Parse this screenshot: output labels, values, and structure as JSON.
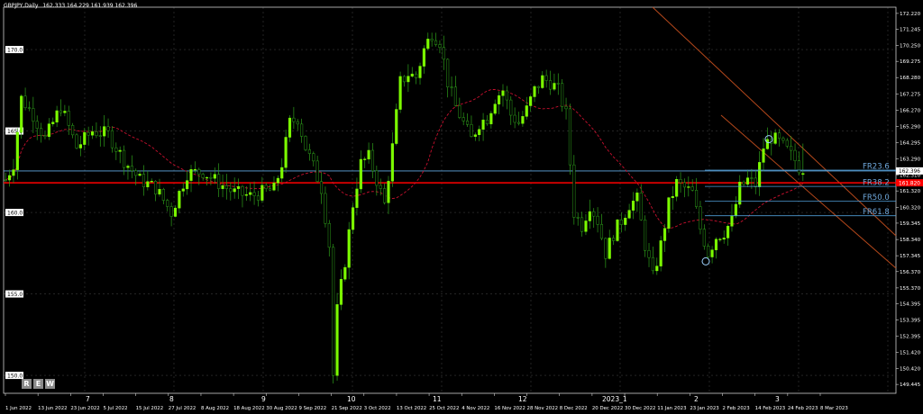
{
  "header": {
    "symbol": "GBPJPY,Daily",
    "ohlc": "162.333 164.229 161.939 162.396"
  },
  "buttons": [
    "R",
    "E",
    "W"
  ],
  "colors": {
    "background": "#000000",
    "bull": "#7CFC00",
    "bear": "#FFFFFF",
    "ma": "#C8102E",
    "channel": "#B5481B",
    "fib_line": "#4F9BD3",
    "bid_line": "#5FA8E0",
    "red_line": "#FF0000",
    "grid": "#3A3A3A"
  },
  "chart_data": {
    "type": "candlestick",
    "symbol": "GBPJPY",
    "timeframe": "Daily",
    "last": {
      "open": 162.333,
      "high": 164.229,
      "low": 161.939,
      "close": 162.396
    },
    "ylim": [
      148.9,
      172.6
    ],
    "y_ticks": [
      172.22,
      171.245,
      170.25,
      169.275,
      168.28,
      167.275,
      166.27,
      165.29,
      164.295,
      163.29,
      162.31,
      161.32,
      160.32,
      159.345,
      158.34,
      157.345,
      156.37,
      155.37,
      154.395,
      153.395,
      152.395,
      151.42,
      150.42,
      149.445
    ],
    "x_labels": [
      "1 Jun 2022",
      "13 Jun 2022",
      "23 Jun 2022",
      "5 Jul 2022",
      "15 Jul 2022",
      "27 Jul 2022",
      "8 Aug 2022",
      "18 Aug 2022",
      "30 Aug 2022",
      "9 Sep 2022",
      "21 Sep 2022",
      "3 Oct 2022",
      "13 Oct 2022",
      "25 Oct 2022",
      "4 Nov 2022",
      "16 Nov 2022",
      "28 Nov 2022",
      "8 Dec 2022",
      "20 Dec 2022",
      "30 Dec 2022",
      "11 Jan 2023",
      "23 Jan 2023",
      "2 Feb 2023",
      "14 Feb 2023",
      "24 Feb 2023",
      "8 Mar 2023"
    ],
    "period_labels": [
      "7",
      "8",
      "9",
      "10",
      "11",
      "12",
      "2023_1",
      "2",
      "3"
    ],
    "level_labels": [
      170.0,
      165.0,
      160.0,
      155.0,
      150.0
    ],
    "fibonacci": [
      {
        "label": "FR23.6",
        "price": 162.6
      },
      {
        "label": "FR38.2",
        "price": 161.6
      },
      {
        "label": "FR50.0",
        "price": 160.7
      },
      {
        "label": "FR61.8",
        "price": 159.8
      }
    ],
    "fib_swing": {
      "low": 157.0,
      "high": 164.5
    },
    "current_price_label": "162.396",
    "red_level_label": "161.820",
    "red_level": 161.82,
    "trend_points": [
      [
        0,
        162.0
      ],
      [
        2,
        163.0
      ],
      [
        4,
        167.0
      ],
      [
        7,
        166.0
      ],
      [
        10,
        164.5
      ],
      [
        14,
        166.5
      ],
      [
        18,
        164.0
      ],
      [
        22,
        165.0
      ],
      [
        26,
        164.8
      ],
      [
        30,
        163.2
      ],
      [
        34,
        162.0
      ],
      [
        38,
        161.5
      ],
      [
        42,
        160.0
      ],
      [
        46,
        162.4
      ],
      [
        50,
        162.5
      ],
      [
        54,
        161.8
      ],
      [
        58,
        161.2
      ],
      [
        62,
        161.0
      ],
      [
        66,
        161.3
      ],
      [
        68,
        161.4
      ],
      [
        70,
        163.0
      ],
      [
        72,
        165.5
      ],
      [
        74,
        165.8
      ],
      [
        76,
        164.0
      ],
      [
        78,
        162.8
      ],
      [
        80,
        161.5
      ],
      [
        82,
        158.0
      ],
      [
        83,
        150.0
      ],
      [
        84,
        154.0
      ],
      [
        86,
        157.0
      ],
      [
        88,
        160.5
      ],
      [
        90,
        163.0
      ],
      [
        92,
        163.4
      ],
      [
        94,
        162.0
      ],
      [
        96,
        160.5
      ],
      [
        98,
        164.0
      ],
      [
        100,
        168.0
      ],
      [
        102,
        168.5
      ],
      [
        104,
        168.3
      ],
      [
        106,
        170.0
      ],
      [
        108,
        171.0
      ],
      [
        110,
        170.5
      ],
      [
        112,
        168.0
      ],
      [
        114,
        166.5
      ],
      [
        116,
        165.5
      ],
      [
        118,
        164.5
      ],
      [
        120,
        165.5
      ],
      [
        122,
        165.8
      ],
      [
        124,
        167.0
      ],
      [
        126,
        167.5
      ],
      [
        128,
        166.0
      ],
      [
        130,
        165.5
      ],
      [
        132,
        166.3
      ],
      [
        134,
        167.5
      ],
      [
        136,
        168.2
      ],
      [
        138,
        168.0
      ],
      [
        140,
        167.5
      ],
      [
        142,
        166.0
      ],
      [
        144,
        160.0
      ],
      [
        146,
        159.2
      ],
      [
        148,
        160.5
      ],
      [
        150,
        159.5
      ],
      [
        152,
        157.5
      ],
      [
        154,
        158.7
      ],
      [
        156,
        159.5
      ],
      [
        158,
        160.5
      ],
      [
        160,
        160.8
      ],
      [
        162,
        158.0
      ],
      [
        164,
        156.0
      ],
      [
        166,
        158.0
      ],
      [
        168,
        160.5
      ],
      [
        170,
        161.8
      ],
      [
        172,
        161.5
      ],
      [
        174,
        161.2
      ],
      [
        176,
        159.0
      ],
      [
        178,
        157.5
      ],
      [
        180,
        158.5
      ],
      [
        182,
        158.8
      ],
      [
        184,
        159.5
      ],
      [
        186,
        161.5
      ],
      [
        188,
        162.0
      ],
      [
        190,
        161.7
      ],
      [
        192,
        164.0
      ],
      [
        194,
        164.6
      ],
      [
        196,
        164.3
      ],
      [
        198,
        163.8
      ],
      [
        200,
        163.2
      ],
      [
        202,
        162.4
      ]
    ]
  }
}
